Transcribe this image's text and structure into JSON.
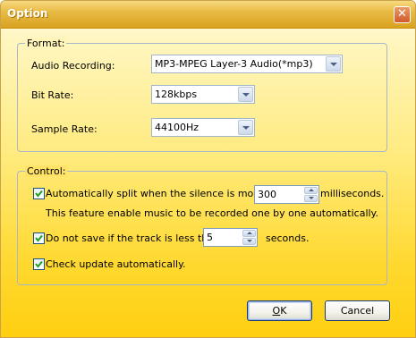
{
  "window": {
    "title": "Option",
    "close_symbol": "✕"
  },
  "format": {
    "legend": "Format:",
    "audio_recording": {
      "label": "Audio Recording:",
      "value": "MP3-MPEG Layer-3 Audio(*mp3)"
    },
    "bit_rate": {
      "label": "Bit Rate:",
      "value": "128kbps"
    },
    "sample_rate": {
      "label": "Sample Rate:",
      "value": "44100Hz"
    }
  },
  "control": {
    "legend": "Control:",
    "auto_split": {
      "checked": true,
      "label": "Automatically split when the silence is more than",
      "value": "300",
      "unit": "milliseconds.",
      "note": "This feature enable music to be recorded one by one automatically."
    },
    "skip_short": {
      "checked": true,
      "label": "Do not save if the track is less than",
      "value": "5",
      "unit": "seconds."
    },
    "check_update": {
      "checked": true,
      "label": "Check update automatically."
    }
  },
  "buttons": {
    "ok": {
      "mnemonic": "O",
      "rest": "K"
    },
    "cancel": "Cancel"
  },
  "colors": {
    "check": "#21a121",
    "title_text": "#ffffff",
    "group_border": "#a9b8c8"
  }
}
